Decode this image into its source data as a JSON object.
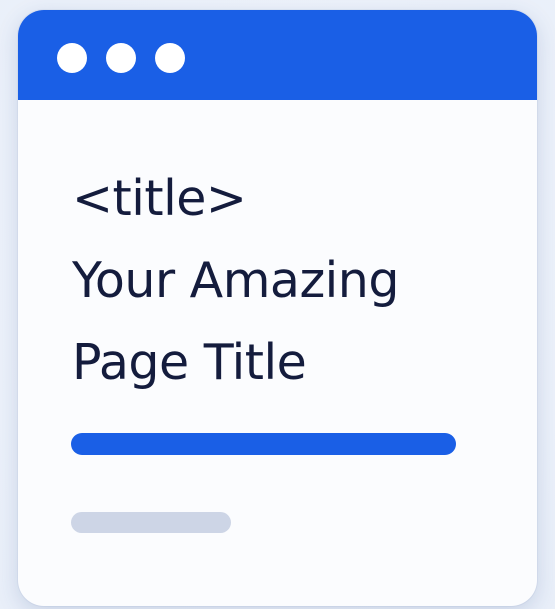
{
  "window": {
    "title_tag": "<title>",
    "title_lines": [
      "Your Amazing",
      "Page Title"
    ],
    "accent_color": "#1a5fe6",
    "text_color": "#141c3d",
    "placeholder_bar_color": "#cdd5e6"
  },
  "icons": {
    "window_controls": [
      "window-dot-icon",
      "window-dot-icon",
      "window-dot-icon"
    ]
  }
}
